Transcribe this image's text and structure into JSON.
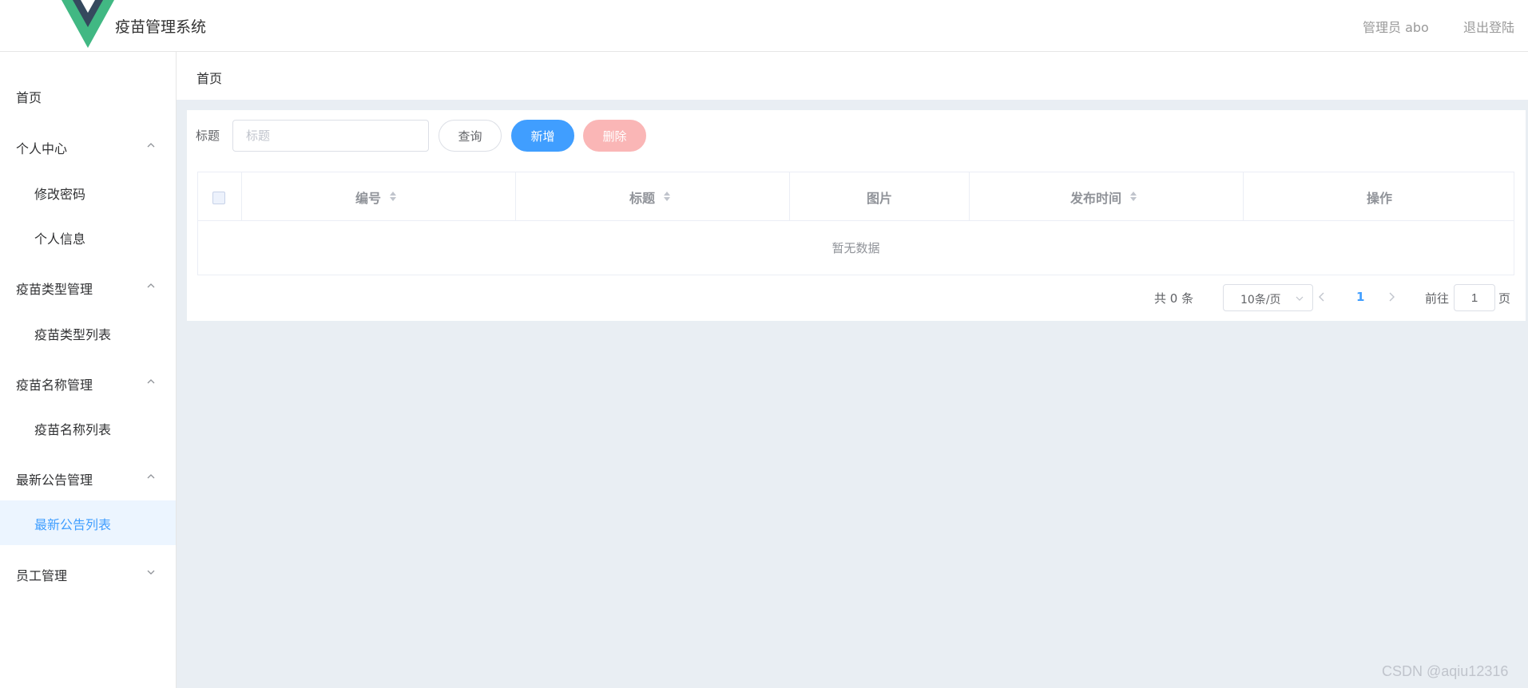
{
  "header": {
    "app_title": "疫苗管理系统",
    "user_label": "管理员 abo",
    "logout_label": "退出登陆",
    "logo_colors": {
      "outer": "#41b883",
      "inner": "#35495e"
    }
  },
  "sidebar": {
    "items": [
      {
        "label": "首页",
        "type": "item"
      },
      {
        "label": "个人中心",
        "type": "group",
        "expanded": true,
        "chevron": "chevron-up-icon"
      },
      {
        "label": "修改密码",
        "type": "sub"
      },
      {
        "label": "个人信息",
        "type": "sub"
      },
      {
        "label": "疫苗类型管理",
        "type": "group",
        "expanded": true,
        "chevron": "chevron-up-icon"
      },
      {
        "label": "疫苗类型列表",
        "type": "sub"
      },
      {
        "label": "疫苗名称管理",
        "type": "group",
        "expanded": true,
        "chevron": "chevron-up-icon"
      },
      {
        "label": "疫苗名称列表",
        "type": "sub"
      },
      {
        "label": "最新公告管理",
        "type": "group",
        "expanded": true,
        "chevron": "chevron-up-icon"
      },
      {
        "label": "最新公告列表",
        "type": "sub",
        "active": true
      },
      {
        "label": "员工管理",
        "type": "group",
        "expanded": false,
        "chevron": "chevron-down-icon"
      }
    ]
  },
  "breadcrumb": {
    "current": "首页"
  },
  "search": {
    "label": "标题",
    "placeholder": "标题",
    "value": "",
    "query_label": "查询",
    "add_label": "新增",
    "delete_label": "删除"
  },
  "table": {
    "columns": [
      {
        "label": "编号",
        "sortable": true
      },
      {
        "label": "标题",
        "sortable": true
      },
      {
        "label": "图片",
        "sortable": false
      },
      {
        "label": "发布时间",
        "sortable": true
      },
      {
        "label": "操作",
        "sortable": false
      }
    ],
    "rows": [],
    "empty_text": "暂无数据"
  },
  "pagination": {
    "total_label": "共 0 条",
    "page_size_label": "10条/页",
    "current_page": "1",
    "goto_label": "前往",
    "goto_value": "1",
    "page_suffix": "页"
  },
  "watermark": "CSDN @aqiu12316",
  "colors": {
    "primary": "#409eff",
    "danger_disabled": "#fab6b6",
    "main_bg": "#e9eef3",
    "active_bg": "#ecf5ff"
  }
}
